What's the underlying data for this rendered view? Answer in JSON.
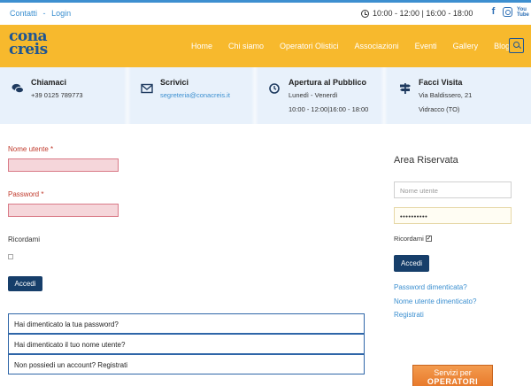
{
  "topbar": {
    "links": [
      "Contatti",
      "Login"
    ],
    "hours": "10:00 - 12:00 | 16:00 - 18:00",
    "social": [
      "facebook-icon",
      "instagram-icon",
      "youtube-icon"
    ]
  },
  "logo": {
    "line1": "cona",
    "line2": "creis"
  },
  "nav": [
    "Home",
    "Chi siamo",
    "Operatori Olistici",
    "Associazioni",
    "Eventi",
    "Gallery",
    "Blog"
  ],
  "info": [
    {
      "title": "Chiamaci",
      "line1": "+39 0125 789773",
      "line2": "",
      "icon": "chat-icon"
    },
    {
      "title": "Scrivici",
      "line1": "segreteria@conacreis.it",
      "line2": "",
      "icon": "envelope-icon"
    },
    {
      "title": "Apertura al Pubblico",
      "line1": "Lunedì - Venerdì",
      "line2": "10:00 - 12:00|16:00 - 18:00",
      "icon": "clock-icon"
    },
    {
      "title": "Facci Visita",
      "line1": "Via Baldissero, 21",
      "line2": "Vidracco (TO)",
      "icon": "signpost-icon"
    }
  ],
  "login": {
    "username_label": "Nome utente *",
    "password_label": "Password *",
    "remember_label": "Ricordami",
    "submit_label": "Accedi",
    "links": [
      "Hai dimenticato la tua password?",
      "Hai dimenticato il tuo nome utente?",
      "Non possiedi un account? Registrati"
    ]
  },
  "sidebar": {
    "title": "Area Riservata",
    "username_placeholder": "Nome utente",
    "password_value": "••••••••••",
    "remember_label": "Ricordami",
    "submit_label": "Accedi",
    "links": [
      "Password dimenticata?",
      "Nome utente dimenticato?",
      "Registrati"
    ]
  },
  "banner": {
    "line1": "Servizi per",
    "line2": "OPERATORI"
  },
  "colors": {
    "accent_blue": "#3b8fd0",
    "header_yellow": "#f7b92d",
    "button_navy": "#163e6a",
    "error_red": "#c0392b"
  }
}
